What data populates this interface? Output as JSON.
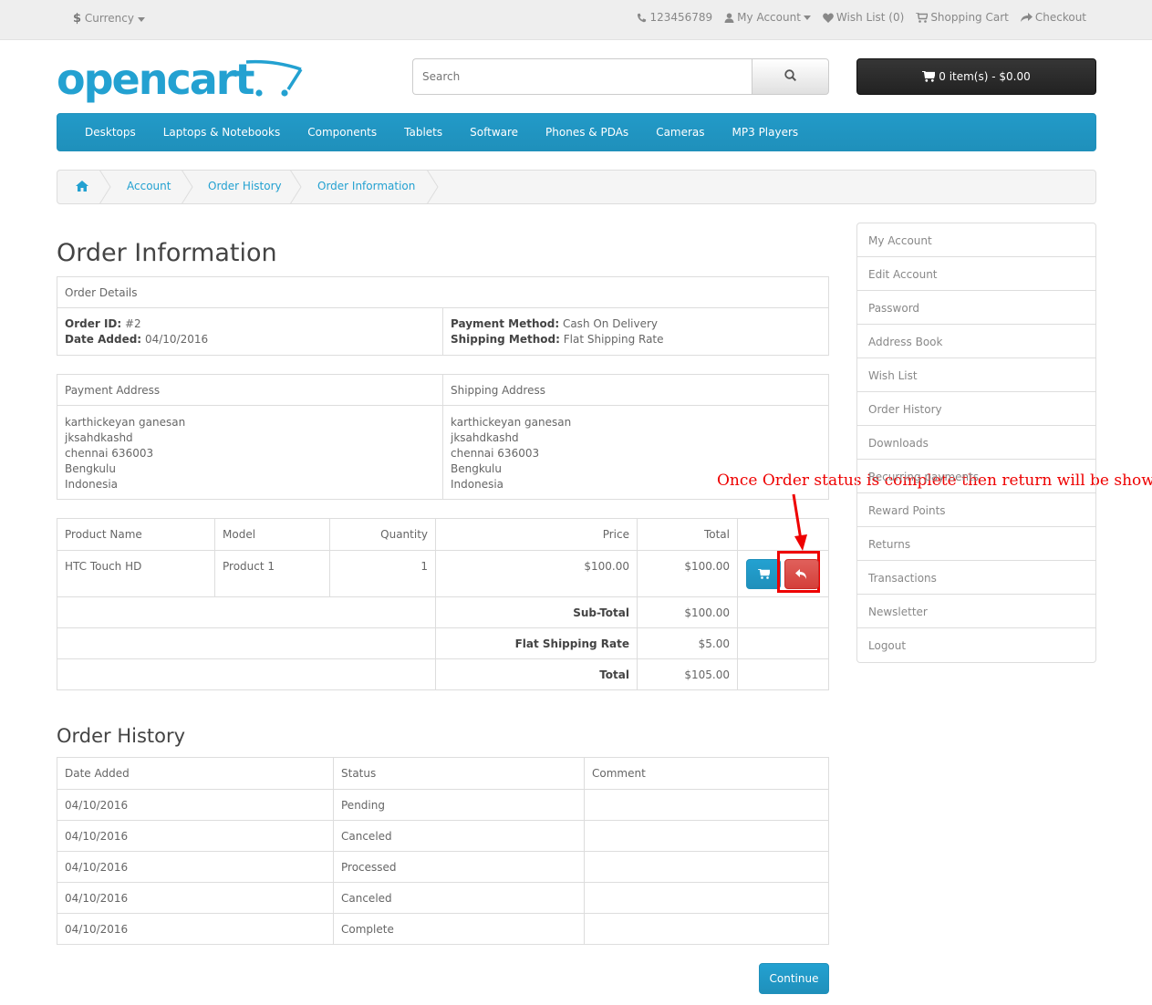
{
  "topbar": {
    "currency_symbol": "$",
    "currency_label": "Currency",
    "phone": "123456789",
    "my_account": "My Account",
    "wishlist": "Wish List (0)",
    "shopping_cart": "Shopping Cart",
    "checkout": "Checkout"
  },
  "header": {
    "logo_text": "opencart",
    "search_placeholder": "Search",
    "cart_label": "0 item(s) - $0.00"
  },
  "menu": [
    "Desktops",
    "Laptops & Notebooks",
    "Components",
    "Tablets",
    "Software",
    "Phones & PDAs",
    "Cameras",
    "MP3 Players"
  ],
  "breadcrumb": [
    "Account",
    "Order History",
    "Order Information"
  ],
  "page_title": "Order Information",
  "order_details": {
    "heading": "Order Details",
    "order_id_label": "Order ID:",
    "order_id": "#2",
    "date_added_label": "Date Added:",
    "date_added": "04/10/2016",
    "payment_method_label": "Payment Method:",
    "payment_method": "Cash On Delivery",
    "shipping_method_label": "Shipping Method:",
    "shipping_method": "Flat Shipping Rate"
  },
  "addresses": {
    "payment_heading": "Payment Address",
    "shipping_heading": "Shipping Address",
    "payment_lines": [
      "karthickeyan ganesan",
      "jksahdkashd",
      "chennai 636003",
      "Bengkulu",
      "Indonesia"
    ],
    "shipping_lines": [
      "karthickeyan ganesan",
      "jksahdkashd",
      "chennai 636003",
      "Bengkulu",
      "Indonesia"
    ]
  },
  "products": {
    "headers": [
      "Product Name",
      "Model",
      "Quantity",
      "Price",
      "Total"
    ],
    "rows": [
      {
        "name": "HTC Touch HD",
        "model": "Product 1",
        "quantity": "1",
        "price": "$100.00",
        "total": "$100.00"
      }
    ],
    "totals": [
      {
        "label": "Sub-Total",
        "value": "$100.00"
      },
      {
        "label": "Flat Shipping Rate",
        "value": "$5.00"
      },
      {
        "label": "Total",
        "value": "$105.00"
      }
    ]
  },
  "annotation": "Once Order status is complete then return will be shown",
  "history": {
    "title": "Order History",
    "headers": [
      "Date Added",
      "Status",
      "Comment"
    ],
    "rows": [
      {
        "date": "04/10/2016",
        "status": "Pending",
        "comment": ""
      },
      {
        "date": "04/10/2016",
        "status": "Canceled",
        "comment": ""
      },
      {
        "date": "04/10/2016",
        "status": "Processed",
        "comment": ""
      },
      {
        "date": "04/10/2016",
        "status": "Canceled",
        "comment": ""
      },
      {
        "date": "04/10/2016",
        "status": "Complete",
        "comment": ""
      }
    ]
  },
  "continue_label": "Continue",
  "account_menu": [
    "My Account",
    "Edit Account",
    "Password",
    "Address Book",
    "Wish List",
    "Order History",
    "Downloads",
    "Recurring payments",
    "Reward Points",
    "Returns",
    "Transactions",
    "Newsletter",
    "Logout"
  ],
  "colors": {
    "brand_blue": "#23a1d1",
    "danger_red": "#d9534f",
    "annotation_red": "#e00000"
  }
}
